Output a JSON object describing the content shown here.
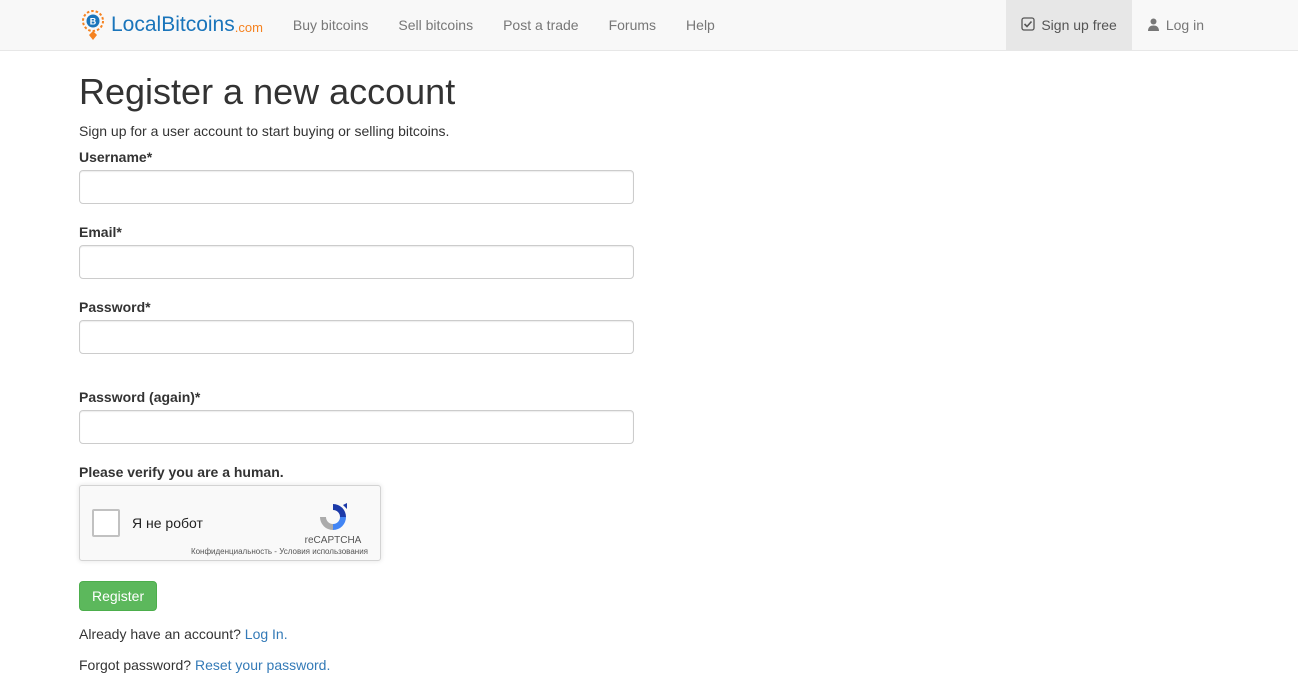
{
  "logo": {
    "main": "LocalBitcoins",
    "sub": ".com"
  },
  "nav": {
    "items": [
      {
        "label": "Buy bitcoins"
      },
      {
        "label": "Sell bitcoins"
      },
      {
        "label": "Post a trade"
      },
      {
        "label": "Forums"
      },
      {
        "label": "Help"
      }
    ],
    "signup": "Sign up free",
    "login": "Log in"
  },
  "page": {
    "title": "Register a new account",
    "subtitle": "Sign up for a user account to start buying or selling bitcoins."
  },
  "form": {
    "username_label": "Username*",
    "email_label": "Email*",
    "password_label": "Password*",
    "password_again_label": "Password (again)*",
    "captcha_heading": "Please verify you are a human.",
    "captcha_checkbox_label": "Я не робот",
    "captcha_brand": "reCAPTCHA",
    "captcha_terms": "Конфиденциальность - Условия использования",
    "register_button": "Register"
  },
  "helpers": {
    "already_text": "Already have an account? ",
    "already_link": "Log In.",
    "forgot_text": "Forgot password? ",
    "forgot_link": "Reset your password."
  }
}
